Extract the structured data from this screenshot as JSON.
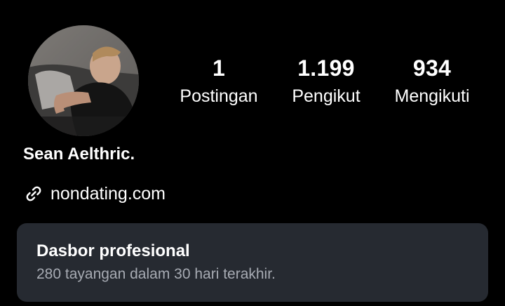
{
  "profile": {
    "avatar_label": "profile-photo",
    "name": "Sean Aelthric.",
    "website": "nondating.com"
  },
  "stats": {
    "posts": {
      "value": "1",
      "label": "Postingan"
    },
    "followers": {
      "value": "1.199",
      "label": "Pengikut"
    },
    "following": {
      "value": "934",
      "label": "Mengikuti"
    }
  },
  "dashboard": {
    "title": "Dasbor profesional",
    "subtitle": "280 tayangan dalam 30 hari terakhir."
  },
  "icons": {
    "link": "link-icon"
  },
  "colors": {
    "background": "#000000",
    "card": "#262a31",
    "text": "#ffffff",
    "muted": "#a7abb3"
  }
}
